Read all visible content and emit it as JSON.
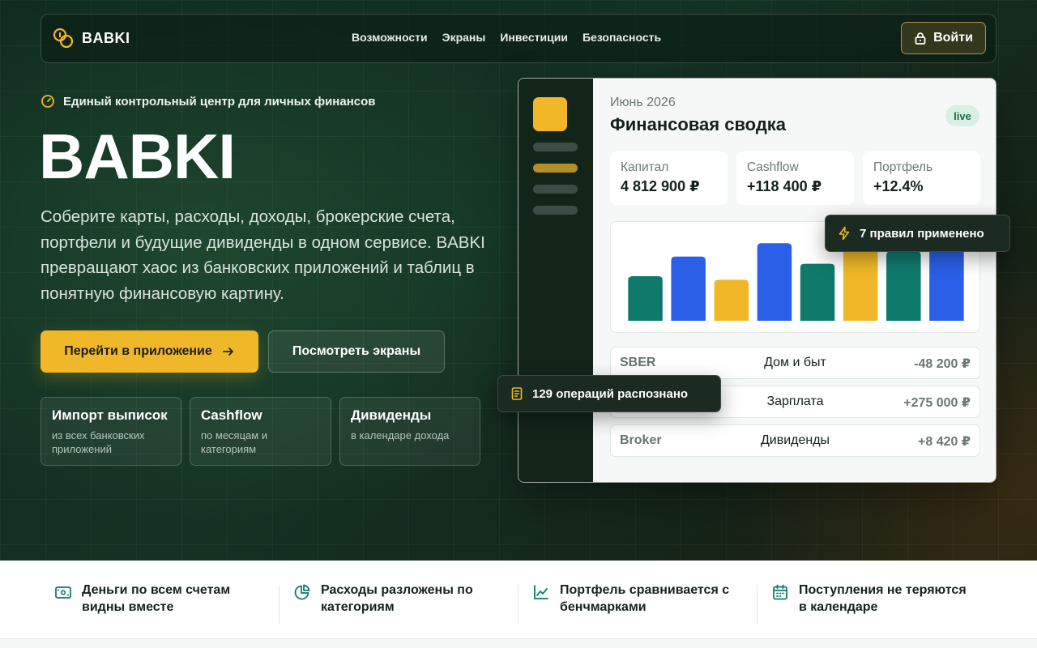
{
  "nav": {
    "brand": "BABKI",
    "menu": [
      "Возможности",
      "Экраны",
      "Инвестиции",
      "Безопасность"
    ],
    "login_label": "Войти"
  },
  "hero": {
    "tagline": "Единый контрольный центр для личных финансов",
    "title": "BABKI",
    "description": "Соберите карты, расходы, доходы, брокерские счета, портфели и будущие дивиденды в одном сервисе. BABKI превращают хаос из банковских приложений и таблиц в понятную финансовую картину.",
    "primary_cta": "Перейти в приложение",
    "secondary_cta": "Посмотреть экраны",
    "features": [
      {
        "title": "Импорт выписок",
        "subtitle": "из всех банковских приложений"
      },
      {
        "title": "Cashflow",
        "subtitle": "по месяцам и категориям"
      },
      {
        "title": "Дивиденды",
        "subtitle": "в календаре дохода"
      }
    ]
  },
  "dashboard": {
    "date": "Июнь 2026",
    "title": "Финансовая сводка",
    "badge": "live",
    "stats": [
      {
        "label": "Капитал",
        "value": "4 812 900 ₽"
      },
      {
        "label": "Cashflow",
        "value": "+118 400 ₽"
      },
      {
        "label": "Портфель",
        "value": "+12.4%"
      }
    ],
    "transactions": [
      {
        "account": "SBER",
        "category": "Дом и быт",
        "amount": "-48 200 ₽"
      },
      {
        "account": "",
        "category": "Зарплата",
        "amount": "+275 000 ₽"
      },
      {
        "account": "Broker",
        "category": "Дивиденды",
        "amount": "+8 420 ₽"
      }
    ]
  },
  "chart_data": {
    "type": "bar",
    "values": [
      50,
      72,
      46,
      87,
      64,
      87,
      78,
      91
    ],
    "colors": [
      "#0f7a6c",
      "#2b5fe8",
      "#f0b828",
      "#2b5fe8",
      "#0f7a6c",
      "#f0b828",
      "#0f7a6c",
      "#2b5fe8"
    ],
    "ylim": [
      0,
      100
    ]
  },
  "toasts": {
    "rules": "7 правил применено",
    "operations": "129 операций распознано"
  },
  "benefits": [
    {
      "text": "Деньги по всем счетам видны вместе",
      "icon": "wallet-icon"
    },
    {
      "text": "Расходы разложены по категориям",
      "icon": "pie-chart-icon"
    },
    {
      "text": "Портфель сравнивается с бенчмарками",
      "icon": "line-chart-icon"
    },
    {
      "text": "Поступления не теряются в календаре",
      "icon": "calendar-icon"
    }
  ],
  "colors": {
    "accent": "#f0b828",
    "teal": "#0f7a6c",
    "blue": "#2b5fe8",
    "dark": "#132419"
  }
}
